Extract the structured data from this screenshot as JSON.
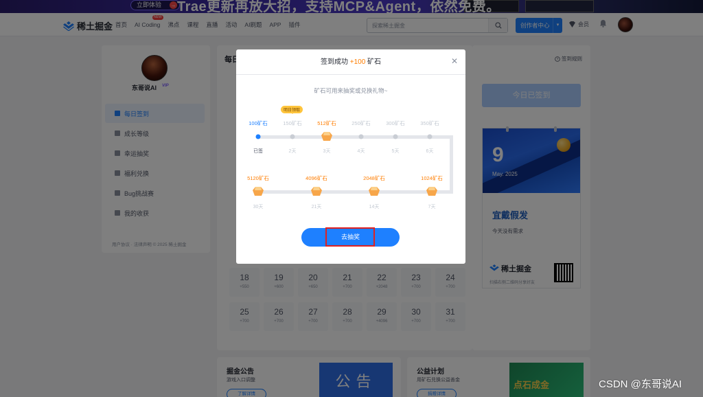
{
  "banner": {
    "button_label": "立即体验",
    "text": "Trae更新再放大招，支持MCP&Agent，依然免费。"
  },
  "nav": {
    "logo_text": "稀土掘金",
    "items": [
      "首页",
      "AI Coding",
      "沸点",
      "课程",
      "直播",
      "活动",
      "AI刷题",
      "APP",
      "插件"
    ],
    "new_badge": "NEW",
    "search_placeholder": "探索稀土掘金",
    "create_label": "创作者中心",
    "vip_label": "会员"
  },
  "sidebar": {
    "username": "东哥说AI",
    "badge": "VIP",
    "items": [
      {
        "label": "每日签到",
        "active": true
      },
      {
        "label": "成长等级",
        "active": false
      },
      {
        "label": "幸运抽奖",
        "active": false
      },
      {
        "label": "福利兑换",
        "active": false
      },
      {
        "label": "Bug挑战赛",
        "active": false
      },
      {
        "label": "我的收获",
        "active": false
      }
    ],
    "footer": "用户协议 · 法律声明 © 2025 稀土掘金"
  },
  "main": {
    "title_visible": "每日",
    "calendar_rows": [
      [
        {
          "day": "18",
          "pts": "+550"
        },
        {
          "day": "19",
          "pts": "+600"
        },
        {
          "day": "20",
          "pts": "+650"
        },
        {
          "day": "21",
          "pts": "+700"
        },
        {
          "day": "22",
          "pts": "+2048"
        },
        {
          "day": "23",
          "pts": "+700"
        },
        {
          "day": "24",
          "pts": "+700"
        }
      ],
      [
        {
          "day": "25",
          "pts": "+700"
        },
        {
          "day": "26",
          "pts": "+700"
        },
        {
          "day": "27",
          "pts": "+700"
        },
        {
          "day": "28",
          "pts": "+700"
        },
        {
          "day": "29",
          "pts": "+4096"
        },
        {
          "day": "30",
          "pts": "+700"
        },
        {
          "day": "31",
          "pts": "+700"
        }
      ]
    ]
  },
  "right": {
    "rules_label": "签到规则",
    "signed_label": "今日已签到",
    "cal_day": "9",
    "cal_month": "May. 2025",
    "cal_title": "宜戴假发",
    "cal_desc": "今天没有需求",
    "cal_logo": "稀土掘金",
    "cal_sub": "扫描右侧二维码分享好友"
  },
  "bottom": {
    "card1": {
      "title": "掘金公告",
      "sub": "游戏入口调整",
      "btn": "了解详情",
      "img": "公告"
    },
    "card2": {
      "title": "公益计划",
      "sub": "用矿石兑换公益善金",
      "btn": "捐赠详情",
      "img": "点石成金"
    }
  },
  "modal": {
    "title_prefix": "签到成功",
    "title_plus": "+100",
    "title_suffix": "矿石",
    "subtitle": "矿石可用来抽奖或兑换礼物~",
    "tomorrow_tag": "明日领取",
    "row1": [
      {
        "reward": "100矿石",
        "day": "已签",
        "state": "signed"
      },
      {
        "reward": "150矿石",
        "day": "2天",
        "state": "normal"
      },
      {
        "reward": "512矿石",
        "day": "3天",
        "state": "gem"
      },
      {
        "reward": "250矿石",
        "day": "4天",
        "state": "normal"
      },
      {
        "reward": "300矿石",
        "day": "5天",
        "state": "normal"
      },
      {
        "reward": "350矿石",
        "day": "6天",
        "state": "normal"
      }
    ],
    "row2": [
      {
        "reward": "5120矿石",
        "day": "30天"
      },
      {
        "reward": "4096矿石",
        "day": "21天"
      },
      {
        "reward": "2048矿石",
        "day": "14天"
      },
      {
        "reward": "1024矿石",
        "day": "7天"
      }
    ],
    "button_label": "去抽奖",
    "colors": {
      "accent": "#1e80ff",
      "orange": "#ff7d00",
      "highlight": "#e02020"
    }
  },
  "watermark": "CSDN @东哥说AI"
}
